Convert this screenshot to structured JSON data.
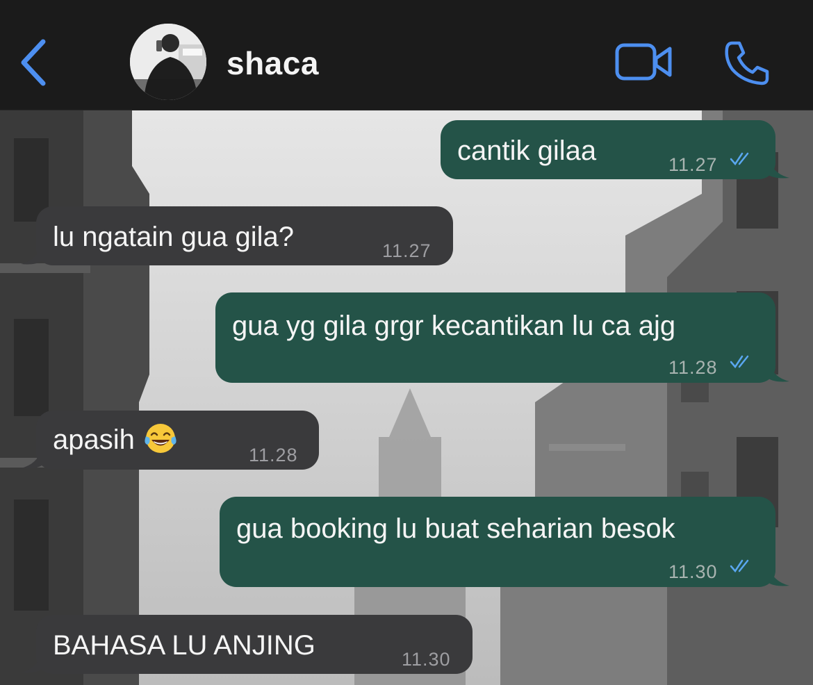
{
  "header": {
    "contact_name": "shaca",
    "back_icon": "chevron-left-icon",
    "video_icon": "video-call-icon",
    "phone_icon": "phone-call-icon",
    "accent_color": "#4d8ff0"
  },
  "messages": [
    {
      "direction": "outgoing",
      "text": "cantik gilaa",
      "time": "11.27",
      "status": "read"
    },
    {
      "direction": "incoming",
      "text": "lu ngatain gua gila?",
      "time": "11.27"
    },
    {
      "direction": "outgoing",
      "text": "gua yg gila grgr kecantikan lu ca ajg",
      "time": "11.28",
      "status": "read"
    },
    {
      "direction": "incoming",
      "text": "apasih",
      "emoji": "face-with-tears-of-joy",
      "time": "11.28"
    },
    {
      "direction": "outgoing",
      "text": "gua booking lu buat seharian besok",
      "time": "11.30",
      "status": "read"
    },
    {
      "direction": "incoming",
      "text": "BAHASA LU ANJING",
      "time": "11.30"
    }
  ],
  "colors": {
    "outgoing_bubble": "#245348",
    "incoming_bubble": "#3a3a3c",
    "read_tick": "#5aa7f0"
  }
}
